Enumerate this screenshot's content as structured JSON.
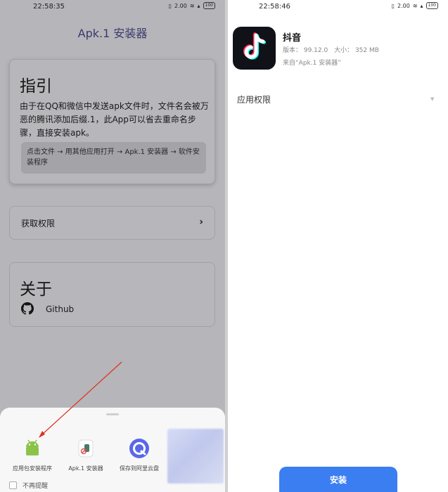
{
  "left": {
    "status_time": "22:58:35",
    "status_net": "2.00",
    "battery": "100",
    "app_title": "Apk.1 安装器",
    "guide": {
      "title": "指引",
      "text": "由于在QQ和微信中发送apk文件时，文件名会被万恶的腾讯添加后缀.1，此App可以省去重命名步骤，直接安装apk。",
      "steps": "点击文件 → 用其他应用打开 → Apk.1 安装器 → 软件安装程序"
    },
    "permission": {
      "label": "获取权限",
      "chevron": "›"
    },
    "about": {
      "title": "关于",
      "github_label": "Github"
    },
    "share_sheet": {
      "targets": [
        {
          "label": "应用包安装程序",
          "icon": "android-icon"
        },
        {
          "label": "Apk.1 安装器",
          "icon": "apk-installer-icon"
        },
        {
          "label": "保存到阿里云盘",
          "icon": "aliyun-drive-icon"
        }
      ],
      "dont_remind": "不再提醒"
    }
  },
  "right": {
    "status_time": "22:58:46",
    "status_net": "2.00",
    "battery": "100",
    "app": {
      "name": "抖音",
      "version": "版本： 99.12.0",
      "size": "大小： 352 MB",
      "source": "来自“Apk.1 安装器”"
    },
    "permissions_label": "应用权限",
    "permissions_caret": "▼",
    "install_label": "安装"
  },
  "colors": {
    "accent": "#3b7ef2",
    "title_color": "#4a4b8c",
    "arrow": "#e0301e"
  }
}
